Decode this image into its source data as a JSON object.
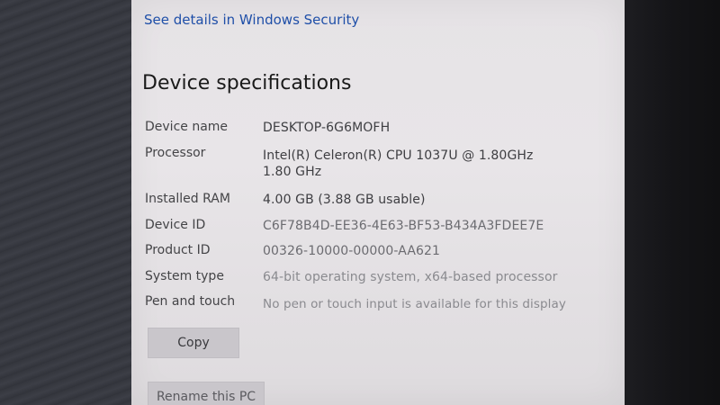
{
  "security": {
    "link_label": "See details in Windows Security"
  },
  "specs": {
    "title": "Device specifications",
    "rows": [
      {
        "label": "Device name",
        "value": "DESKTOP-6G6MOFH"
      },
      {
        "label": "Processor",
        "value": "Intel(R) Celeron(R) CPU 1037U @ 1.80GHz   1.80 GHz"
      },
      {
        "label": "Installed RAM",
        "value": "4.00 GB (3.88 GB usable)"
      },
      {
        "label": "Device ID",
        "value": "C6F78B4D-EE36-4E63-BF53-B434A3FDEE7E"
      },
      {
        "label": "Product ID",
        "value": "00326-10000-00000-AA621"
      },
      {
        "label": "System type",
        "value": "64-bit operating system, x64-based processor"
      },
      {
        "label": "Pen and touch",
        "value": "No pen or touch input is available for this display"
      }
    ]
  },
  "buttons": {
    "copy": "Copy",
    "rename": "Rename this PC"
  }
}
